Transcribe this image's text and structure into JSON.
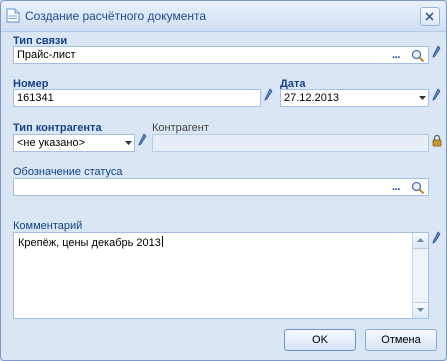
{
  "window": {
    "title": "Создание расчётного документа"
  },
  "form": {
    "link_type": {
      "label": "Тип связи",
      "value": "Прайс-лист"
    },
    "number": {
      "label": "Номер",
      "value": "161341"
    },
    "date": {
      "label": "Дата",
      "value": "27.12.2013"
    },
    "counterparty_type": {
      "label": "Тип контрагента",
      "value": "<не указано>"
    },
    "counterparty": {
      "label": "Контрагент",
      "value": ""
    },
    "status": {
      "label": "Обозначение статуса",
      "value": ""
    },
    "comment": {
      "label": "Комментарий",
      "value": "Крепёж, цены декабрь 2013"
    }
  },
  "buttons": {
    "ok": "OK",
    "cancel": "Отмена"
  },
  "icons": {
    "app": "document-icon",
    "close": "close-icon",
    "lookup": "ellipsis-icon",
    "search": "magnifier-icon",
    "edit": "pencil-icon",
    "locked": "lock-icon"
  },
  "colors": {
    "window_bg": "#dae6f4",
    "label": "#15428b",
    "border": "#a5bfe0"
  }
}
